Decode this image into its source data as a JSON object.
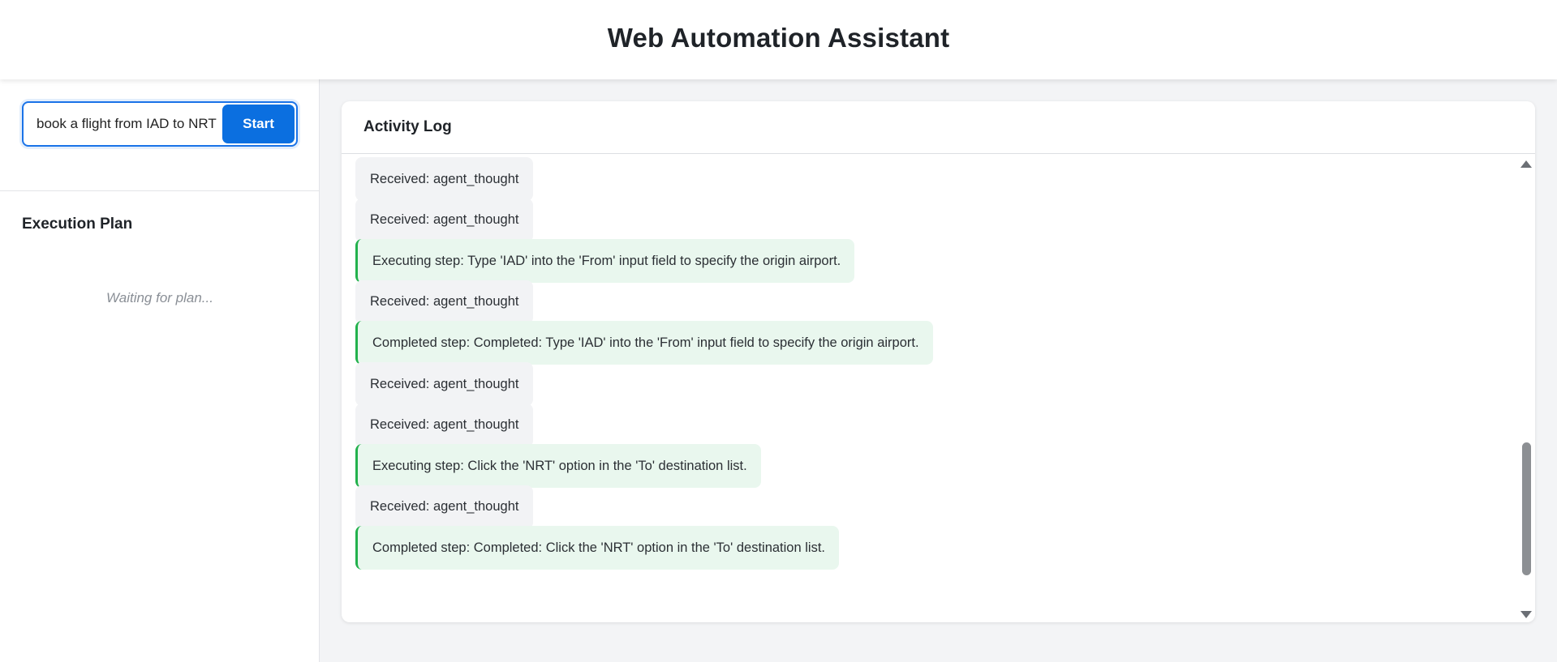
{
  "app": {
    "title": "Web Automation Assistant"
  },
  "task": {
    "input_value": "book a flight from IAD to NRT",
    "start_label": "Start"
  },
  "plan": {
    "title": "Execution Plan",
    "waiting_text": "Waiting for plan..."
  },
  "log": {
    "title": "Activity Log",
    "entries": [
      {
        "type": "info",
        "text": "Received: agent_thought"
      },
      {
        "type": "info",
        "text": "Received: agent_thought"
      },
      {
        "type": "step",
        "text": "Executing step: Type 'IAD' into the 'From' input field to specify the origin airport."
      },
      {
        "type": "info",
        "text": "Received: agent_thought"
      },
      {
        "type": "step",
        "text": "Completed step: Completed: Type 'IAD' into the 'From' input field to specify the origin airport."
      },
      {
        "type": "info",
        "text": "Received: agent_thought"
      },
      {
        "type": "info",
        "text": "Received: agent_thought"
      },
      {
        "type": "step",
        "text": "Executing step: Click the 'NRT' option in the 'To' destination list."
      },
      {
        "type": "info",
        "text": "Received: agent_thought"
      },
      {
        "type": "step",
        "text": "Completed step: Completed: Click the 'NRT' option in the 'To' destination list."
      }
    ]
  },
  "colors": {
    "accent": "#0b6fe0",
    "step_border": "#22b14c",
    "step_background": "#e9f7ee",
    "info_background": "#f2f3f5"
  }
}
